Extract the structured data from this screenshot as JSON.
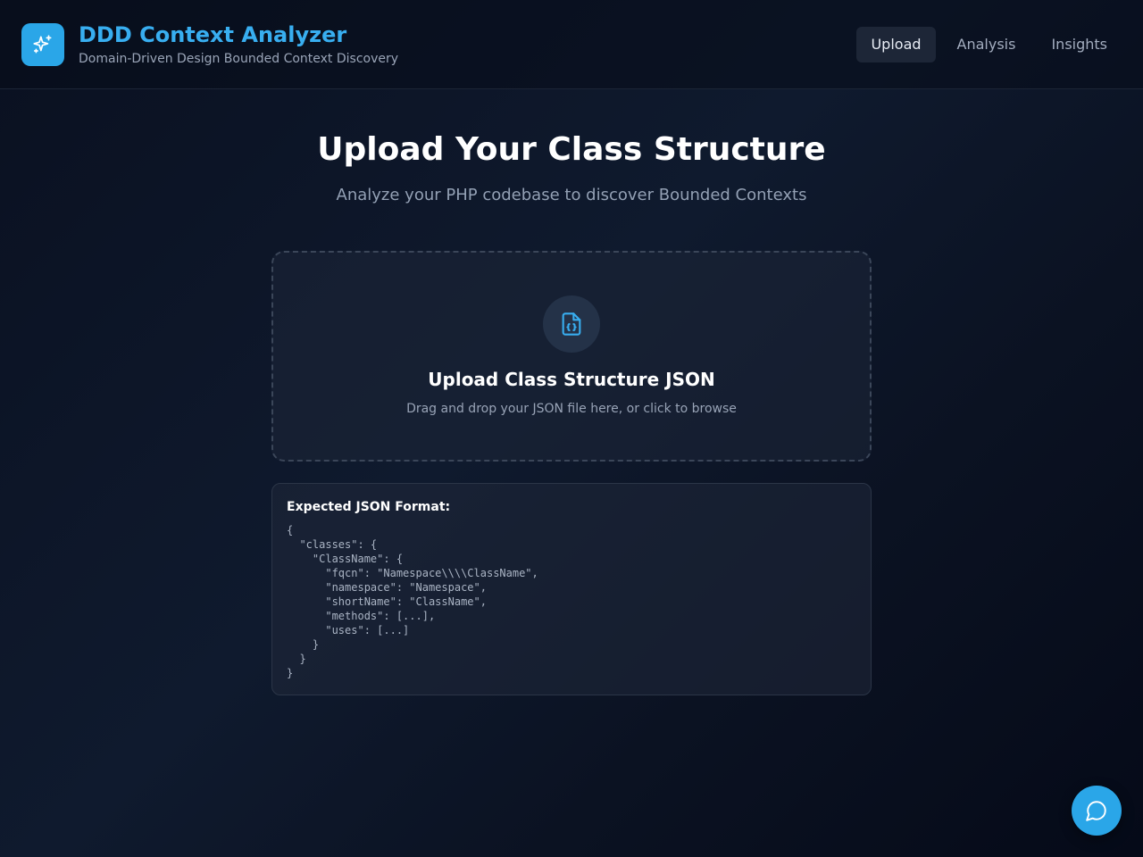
{
  "app": {
    "title": "DDD Context Analyzer",
    "subtitle": "Domain-Driven Design Bounded Context Discovery",
    "logo_icon": "sparkles-icon",
    "accent_color": "#2aa6e8"
  },
  "nav": {
    "tabs": [
      {
        "label": "Upload",
        "active": true
      },
      {
        "label": "Analysis",
        "active": false
      },
      {
        "label": "Insights",
        "active": false
      }
    ]
  },
  "main": {
    "title": "Upload Your Class Structure",
    "subtitle": "Analyze your PHP codebase to discover Bounded Contexts"
  },
  "dropzone": {
    "icon": "file-json-icon",
    "title": "Upload Class Structure JSON",
    "text": "Drag and drop your JSON file here, or click to browse"
  },
  "format": {
    "title": "Expected JSON Format:",
    "code": "{\n  \"classes\": {\n    \"ClassName\": {\n      \"fqcn\": \"Namespace\\\\\\\\ClassName\",\n      \"namespace\": \"Namespace\",\n      \"shortName\": \"ClassName\",\n      \"methods\": [...],\n      \"uses\": [...]\n    }\n  }\n}"
  },
  "chat": {
    "icon": "chat-bubble-icon"
  }
}
